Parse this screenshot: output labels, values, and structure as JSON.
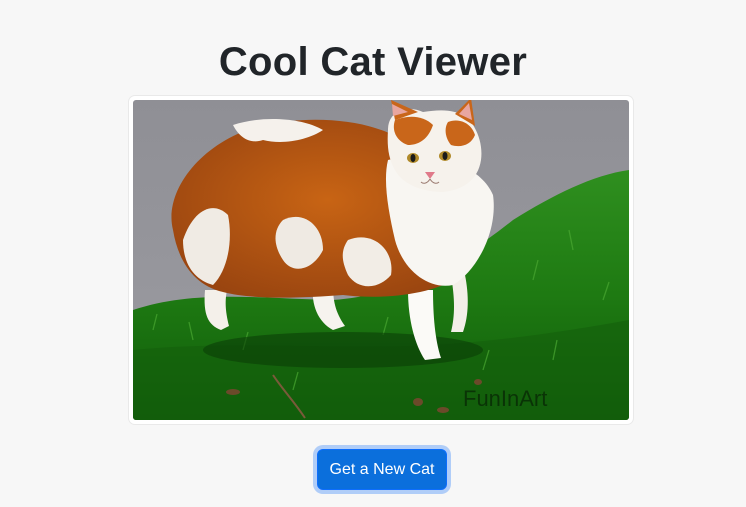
{
  "page": {
    "title": "Cool Cat Viewer"
  },
  "image": {
    "subject": "fluffy orange and white cat standing on grass",
    "watermark": "FunInArt"
  },
  "button": {
    "label": "Get a New Cat"
  },
  "colors": {
    "background": "#f7f7f7",
    "title": "#212529",
    "button": "#0b6fdc",
    "button_text": "#ffffff"
  }
}
